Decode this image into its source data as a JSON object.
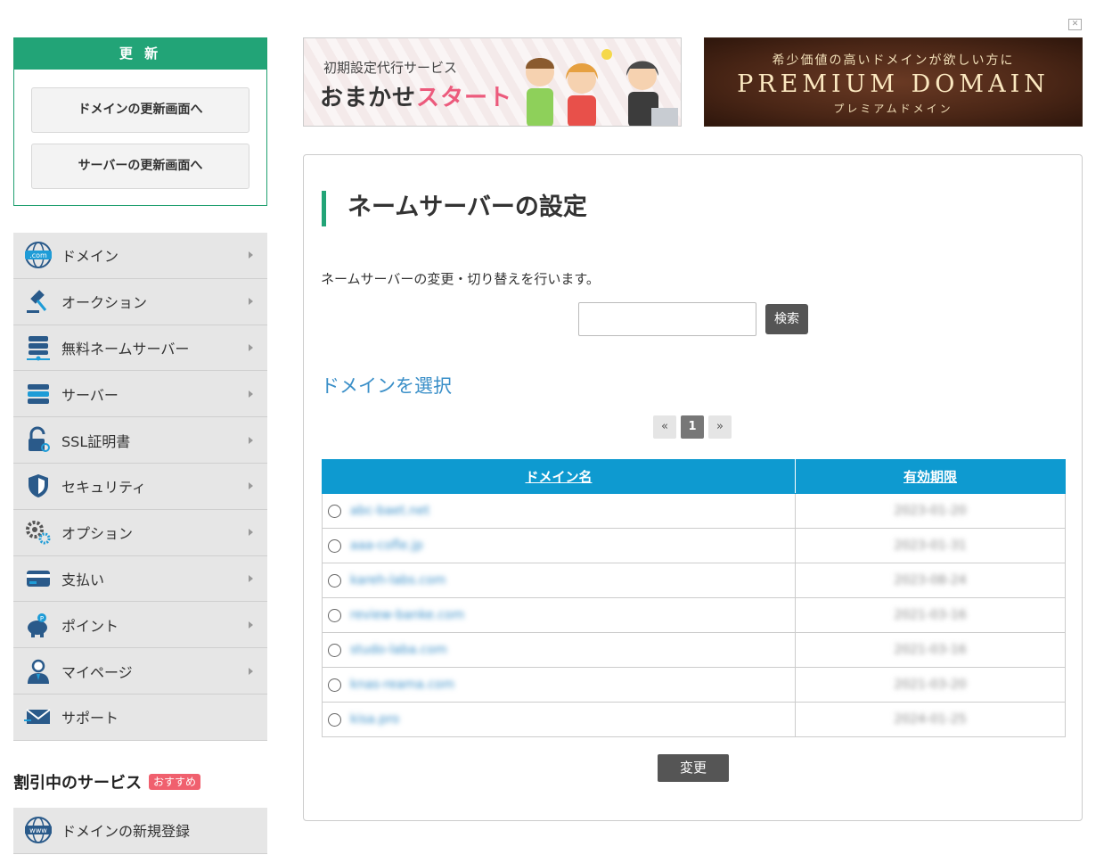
{
  "renew": {
    "header": "更 新",
    "domain_button": "ドメインの更新画面へ",
    "server_button": "サーバーの更新画面へ"
  },
  "menu": [
    {
      "label": "ドメイン",
      "icon": "globe-com-icon"
    },
    {
      "label": "オークション",
      "icon": "gavel-icon"
    },
    {
      "label": "無料ネームサーバー",
      "icon": "server-network-icon"
    },
    {
      "label": "サーバー",
      "icon": "server-icon"
    },
    {
      "label": "SSL証明書",
      "icon": "lock-key-icon"
    },
    {
      "label": "セキュリティ",
      "icon": "shield-icon"
    },
    {
      "label": "オプション",
      "icon": "gears-icon"
    },
    {
      "label": "支払い",
      "icon": "credit-card-icon"
    },
    {
      "label": "ポイント",
      "icon": "piggy-bank-icon"
    },
    {
      "label": "マイページ",
      "icon": "user-icon"
    },
    {
      "label": "サポート",
      "icon": "mail-icon"
    }
  ],
  "discount": {
    "title": "割引中のサービス",
    "badge": "おすすめ",
    "items": [
      {
        "label": "ドメインの新規登録",
        "icon": "globe-www-icon"
      }
    ]
  },
  "banners": {
    "left": {
      "sub": "初期設定代行サービス",
      "main_a": "おまかせ",
      "main_b": "スタート"
    },
    "right": {
      "sub": "希少価値の高いドメインが欲しい方に",
      "main": "PREMIUM DOMAIN",
      "foot": "プレミアムドメイン"
    }
  },
  "page": {
    "title": "ネームサーバーの設定",
    "description": "ネームサーバーの変更・切り替えを行います。",
    "search_value": "",
    "search_button": "検索",
    "select_heading": "ドメインを選択",
    "pager": {
      "prev": "«",
      "current": "1",
      "next": "»"
    },
    "change_button": "変更"
  },
  "table": {
    "columns": [
      "ドメイン名",
      "有効期限"
    ],
    "rows": [
      {
        "domain": "abc-baet.net",
        "expiry": "2023-01-20"
      },
      {
        "domain": "aaa-cofle.jp",
        "expiry": "2023-01-31"
      },
      {
        "domain": "kareh-labs.com",
        "expiry": "2023-08-24"
      },
      {
        "domain": "review-banke.com",
        "expiry": "2021-03-16"
      },
      {
        "domain": "studo-laba.com",
        "expiry": "2021-03-16"
      },
      {
        "domain": "knas-reama.com",
        "expiry": "2021-03-20"
      },
      {
        "domain": "kisa.pro",
        "expiry": "2024-01-25"
      }
    ]
  },
  "colors": {
    "accent": "#22a477",
    "table_header": "#0e9ad0",
    "link": "#3a8fc8",
    "badge": "#f0606e"
  }
}
